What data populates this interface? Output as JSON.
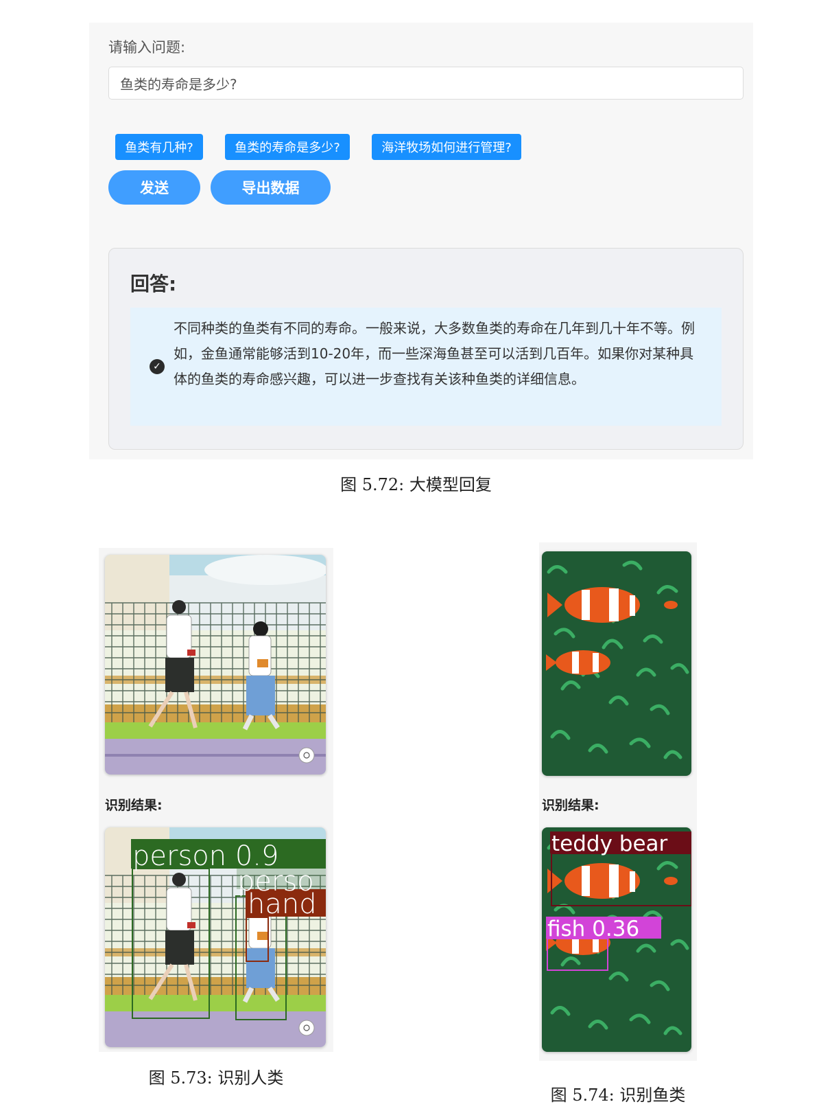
{
  "qa": {
    "prompt_label": "请输入问题:",
    "input_value": "鱼类的寿命是多少?",
    "suggestions": [
      "鱼类有几种?",
      "鱼类的寿命是多少?",
      "海洋牧场如何进行管理?"
    ],
    "send_label": "发送",
    "export_label": "导出数据",
    "answer_title": "回答:",
    "answer_text": "不同种类的鱼类有不同的寿命。一般来说，大多数鱼类的寿命在几年到几十年不等。例如，金鱼通常能够活到10-20年，而一些深海鱼甚至可以活到几百年。如果你对某种具体的鱼类的寿命感兴趣，可以进一步查找有关该种鱼类的详细信息。"
  },
  "captions": {
    "fig_572": "图 5.72: 大模型回复",
    "fig_573": "图 5.73: 识别人类",
    "fig_574": "图 5.74: 识别鱼类"
  },
  "people_panel": {
    "result_label": "识别结果:",
    "detections": [
      "person 0.9",
      "perso",
      "hand"
    ]
  },
  "fish_panel": {
    "result_label": "识别结果:",
    "detections": [
      "teddy bear",
      "fish 0.36"
    ]
  },
  "colors": {
    "button_blue": "#409eff",
    "suggest_blue": "#1890ff",
    "answer_bg": "#e5f3fd",
    "person_box": "#2c6a22",
    "hand_box": "#8b2a0e",
    "teddy_box": "#6b0d17",
    "fish_box": "#d244d8"
  }
}
